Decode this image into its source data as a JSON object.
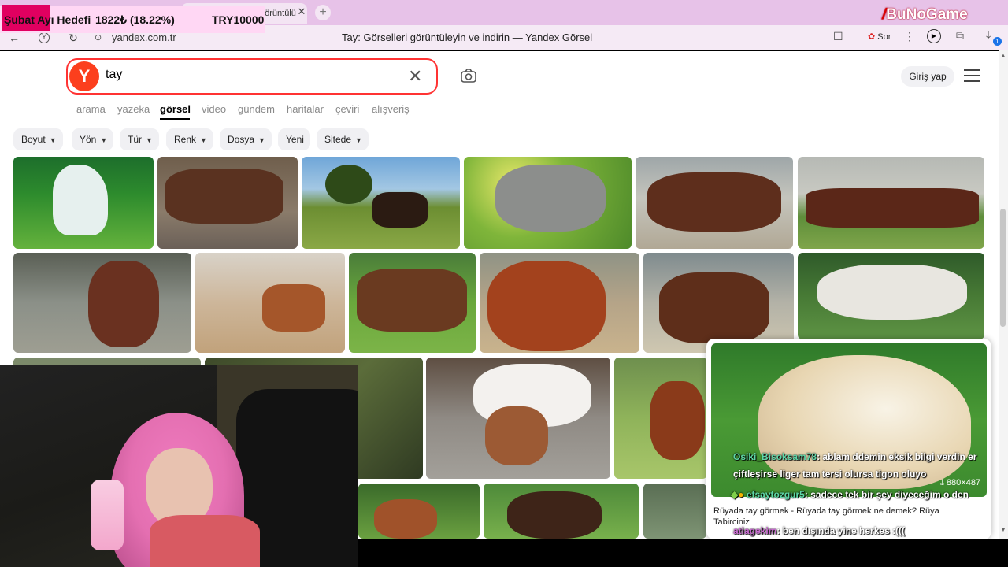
{
  "browser": {
    "tab_title": "görüntülü",
    "url": "yandex.com.tr",
    "page_title": "Tay: Görselleri görüntüleyin ve indirin — Yandex Görsel",
    "ask_label": "Sor",
    "download_badge": "1"
  },
  "overlay": {
    "goal_title": "Şubat Ayı Hedefi",
    "goal_value": "1822₺ (18.22%)",
    "goal_target": "TRY10000",
    "goal_progress": 0.1822,
    "watermark": "BuNoGame"
  },
  "search": {
    "query": "tay",
    "login_label": "Giriş yap",
    "services": [
      "arama",
      "yazeka",
      "görsel",
      "video",
      "gündem",
      "haritalar",
      "çeviri",
      "alışveriş"
    ],
    "active_service": "görsel"
  },
  "filters": [
    "Boyut",
    "Yön",
    "Tür",
    "Renk",
    "Dosya",
    "Yeni",
    "Sitede"
  ],
  "preview": {
    "size": "880×487",
    "text": "Rüyada tay görmek - Rüyada tay görmek ne demek? Rüya Tabirciniz"
  },
  "chat": [
    {
      "user": "Osiki_Bisoksam78",
      "message": ": ablam ddemin eksik bilgi verdin er"
    },
    {
      "user": "",
      "message": "çiftleşirse liger tam tersi olursa tigon oluyo"
    },
    {
      "user": "efsaytozgur5",
      "message": ": sadece tek bir şey diyeceğim o den"
    },
    {
      "user": "atiagekim",
      "message": ": ben dışında yine herkes :((("
    }
  ],
  "colors": {
    "accent": "#fc3f1d",
    "tabbar": "#e7c2e8",
    "goal_bg": "#ffd7f4",
    "goal_label": "#e10060"
  }
}
